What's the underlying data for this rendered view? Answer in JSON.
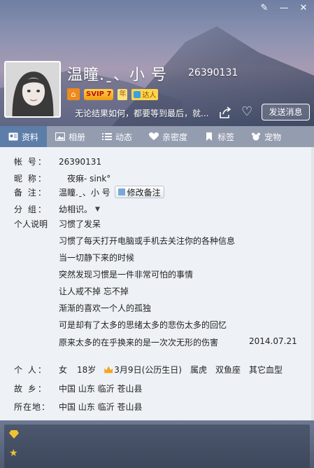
{
  "window": {
    "controls": [
      "✎",
      "—",
      "✕"
    ]
  },
  "profile": {
    "nickname": "温瞳.ˍ、小 号",
    "uin": "26390131",
    "svip_label": "SVIP 7",
    "year_label": "年",
    "daren_label": "达人",
    "signature": "无论结果如何，都要等到最后，就...",
    "send_message": "发送消息"
  },
  "tabs": [
    {
      "label": "资料",
      "icon": "profile-card-icon"
    },
    {
      "label": "相册",
      "icon": "photo-album-icon"
    },
    {
      "label": "动态",
      "icon": "feed-icon"
    },
    {
      "label": "亲密度",
      "icon": "heart-icon"
    },
    {
      "label": "标签",
      "icon": "bookmark-icon"
    },
    {
      "label": "宠物",
      "icon": "pet-icon"
    }
  ],
  "info": {
    "account_label": "帐  号：",
    "account_value": "26390131",
    "nick_label": "昵  称：",
    "nick_value": "夜痳- sink°",
    "remark_label": "备  注：",
    "remark_value": "温瞳.ˍ、小 号",
    "remark_button": "修改备注",
    "group_label": "分  组：",
    "group_value": "幼相识。",
    "intro_label": "个人说明",
    "intro_lines": [
      "习惯了发呆",
      "习惯了每天打开电脑或手机去关注你的各种信息",
      "当一切静下来的时候",
      "突然发现习惯是一件非常可怕的事情",
      "让人戒不掉 忘不掉",
      "渐渐的喜欢一个人的孤独",
      "可是却有了太多的思绪太多的悲伤太多的回忆",
      "原来太多的在乎换来的是一次次无形的伤害"
    ],
    "intro_date": "2014.07.21",
    "personal_label": "个  人：",
    "gender": "女",
    "age": "18岁",
    "birthday": "3月9日(公历生日)",
    "zodiac": "属虎",
    "constellation": "双鱼座",
    "blood_type": "其它血型",
    "hometown_label": "故  乡：",
    "hometown": "中国 山东 临沂 苍山县",
    "location_label": "所在地：",
    "location": "中国 山东 临沂 苍山县"
  }
}
